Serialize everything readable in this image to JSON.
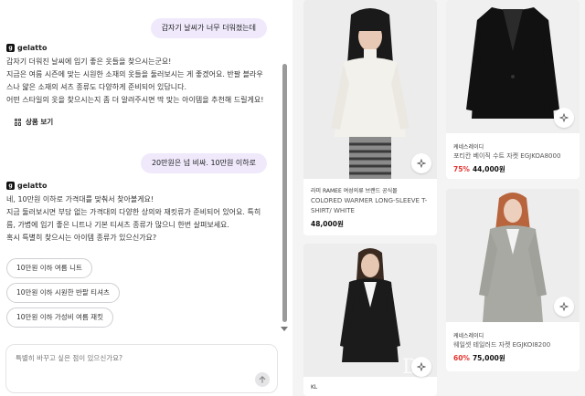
{
  "chat": {
    "messages": [
      {
        "role": "user",
        "text": "갑자기 날씨가 너무 더워졌는데"
      },
      {
        "role": "assistant",
        "bot_name": "gelatto",
        "lines": [
          "갑자기 더워진 날씨에 입기 좋은 옷들을 찾으시는군요!",
          "지금은 여름 시즌에 맞는 시원한 소재의 옷들을 둘러보시는 게 좋겠어요. 반팔 블라우",
          "스나 얇은 소재의 셔츠 종류도 다양하게 준비되어 있답니다.",
          "어떤 스타일의 옷을 찾으시는지 좀 더 알려주시면 딱 맞는 아이템을 추천해 드릴게요!"
        ],
        "products_link": "상품 보기"
      },
      {
        "role": "user",
        "text": "20만원은 넘 비싸. 10만원 이하로"
      },
      {
        "role": "assistant",
        "bot_name": "gelatto",
        "lines": [
          "네, 10만원 이하로 가격대를 맞춰서 찾아볼게요!",
          "지금 둘러보시면 부담 없는 가격대의 다양한 상의와 재킷류가 준비되어 있어요. 특히",
          "름, 가볍에 입기 좋은 니트나 기본 티셔츠 종류가 많으니 한번 살펴보세요.",
          "혹시 특별히 찾으시는 아이템 종류가 있으신가요?"
        ]
      }
    ],
    "suggestions": [
      "10만원 이하 여름 니트",
      "10만원 이하 시원한 반팔 티셔츠",
      "10만원 이하 가성비 여름 재킷"
    ],
    "composer": {
      "placeholder": "특별히 바꾸고 싶은 점이 있으신가요?"
    }
  },
  "products": [
    {
      "brand": "라미 RAMEE 여성의류 브랜드 공식몰",
      "name": "COLORED WARMER LONG-SLEEVE T-SHIRT/ WHITE",
      "discount": "",
      "price": "48,000원",
      "image": "model-white-knit"
    },
    {
      "brand": "케네스레이디",
      "name": "포티칸 베이직 수트 자켓 EGJKOA8000",
      "discount": "75%",
      "price": "44,000원",
      "image": "black-suit-jacket"
    },
    {
      "brand": "KL",
      "name": "",
      "discount": "",
      "price": "",
      "image": "model-black-jacket"
    },
    {
      "brand": "케네스레이디",
      "name": "웨일셋 테일러드 자켓 EGJKOI8200",
      "discount": "60%",
      "price": "75,000원",
      "image": "model-grey-suit"
    }
  ],
  "colors": {
    "accent": "#efe9fb",
    "discount": "#e3342f"
  }
}
